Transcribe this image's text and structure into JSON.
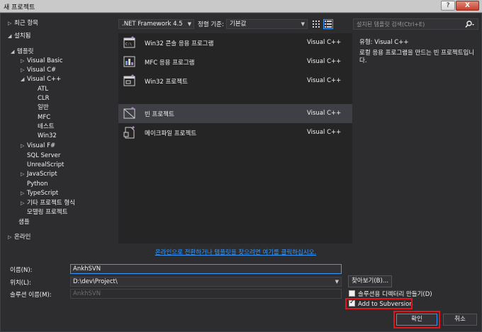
{
  "window": {
    "title": "새 프로젝트",
    "help": "?",
    "close": "X"
  },
  "tree": {
    "recent": "최근 항목",
    "installed": "설치됨",
    "templates": "템플릿",
    "items": [
      {
        "label": "Visual Basic"
      },
      {
        "label": "Visual C#"
      },
      {
        "label": "Visual C++"
      }
    ],
    "cpp_children": [
      "ATL",
      "CLR",
      "일반",
      "MFC",
      "테스트",
      "Win32"
    ],
    "more": [
      {
        "label": "Visual F#",
        "arrow": true
      },
      {
        "label": "SQL Server",
        "arrow": false
      },
      {
        "label": "UnrealScript",
        "arrow": false
      },
      {
        "label": "JavaScript",
        "arrow": true
      },
      {
        "label": "Python",
        "arrow": false
      },
      {
        "label": "TypeScript",
        "arrow": true
      },
      {
        "label": "기타 프로젝트 형식",
        "arrow": true
      },
      {
        "label": "모델링 프로젝트",
        "arrow": false
      }
    ],
    "samples": "샘플",
    "online": "온라인"
  },
  "toolbar": {
    "framework": ".NET Framework 4.5",
    "sort_label": "정렬 기준:",
    "sort_value": "기본값"
  },
  "templates": [
    {
      "name": "Win32 콘솔 응용 프로그램",
      "lang": "Visual C++"
    },
    {
      "name": "MFC 응용 프로그램",
      "lang": "Visual C++"
    },
    {
      "name": "Win32 프로젝트",
      "lang": "Visual C++"
    },
    {
      "name": "빈 프로젝트",
      "lang": "Visual C++"
    },
    {
      "name": "메이크파일 프로젝트",
      "lang": "Visual C++"
    }
  ],
  "search": {
    "placeholder": "설치된 템플릿 검색(Ctrl+E)"
  },
  "description": {
    "type": "유형:  Visual C++",
    "text": "로컬 응용 프로그램을 만드는 빈 프로젝트입니다."
  },
  "online_link": "온라인으로 전환하거나 템플릿을 찾으려면 여기를 클릭하십시오.",
  "form": {
    "name_label": "이름(N):",
    "name_value": "AnkhSVN",
    "location_label": "위치(L):",
    "location_value": "D:\\dev\\Project\\",
    "solution_label": "솔루션 이름(M):",
    "solution_value": "AnkhSVN",
    "browse": "찾아보기(B)...",
    "create_dir": "솔루션용 디렉터리 만들기(D)",
    "add_svn": "Add to Subversion",
    "ok": "확인",
    "cancel": "취소"
  },
  "colors": {
    "accent": "#3399ff",
    "highlight": "#e3141c",
    "background": "#2d2d30"
  }
}
